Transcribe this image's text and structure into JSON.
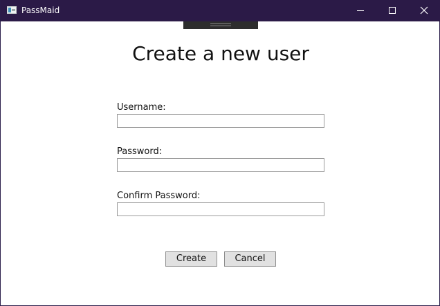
{
  "window": {
    "title": "PassMaid",
    "controls": {
      "minimize_icon": "minimize-icon",
      "maximize_icon": "maximize-icon",
      "close_icon": "close-icon"
    },
    "titlebar_color": "#2b1a47"
  },
  "form": {
    "heading": "Create a new user",
    "fields": [
      {
        "label": "Username:",
        "value": ""
      },
      {
        "label": "Password:",
        "value": ""
      },
      {
        "label": "Confirm Password:",
        "value": ""
      }
    ],
    "buttons": {
      "create": "Create",
      "cancel": "Cancel"
    }
  }
}
